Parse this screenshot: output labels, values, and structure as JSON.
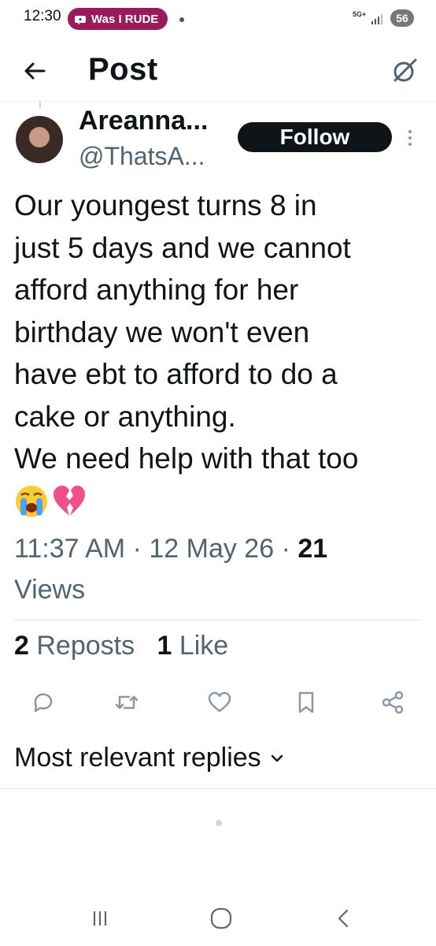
{
  "status_bar": {
    "time": "12:30",
    "notification_pill": "Was I RUDE",
    "network": "5G+",
    "battery": "56"
  },
  "header": {
    "title": "Post"
  },
  "post": {
    "author_name": "Areanna...",
    "author_handle": "@ThatsA...",
    "follow_label": "Follow",
    "text": "Our youngest turns 8 in\njust 5 days and we cannot\nafford anything for her\nbirthday we won't even\nhave ebt to afford to do a\ncake or anything.\nWe need help with that too",
    "emojis": [
      "loudly-crying-face",
      "broken-heart"
    ],
    "time": "11:37 AM",
    "date": "12 May 26",
    "views_count": "21",
    "views_label": "Views",
    "reposts_count": "2",
    "reposts_label": "Reposts",
    "likes_count": "1",
    "likes_label": "Like"
  },
  "actions": [
    "reply-icon",
    "repost-icon",
    "like-icon",
    "bookmark-icon",
    "share-icon"
  ],
  "replies": {
    "sort_label": "Most relevant replies"
  },
  "colors": {
    "text": "#0f1419",
    "secondary_text": "#536471",
    "icon": "#8b98a5",
    "pill": "#9b1a5a"
  }
}
